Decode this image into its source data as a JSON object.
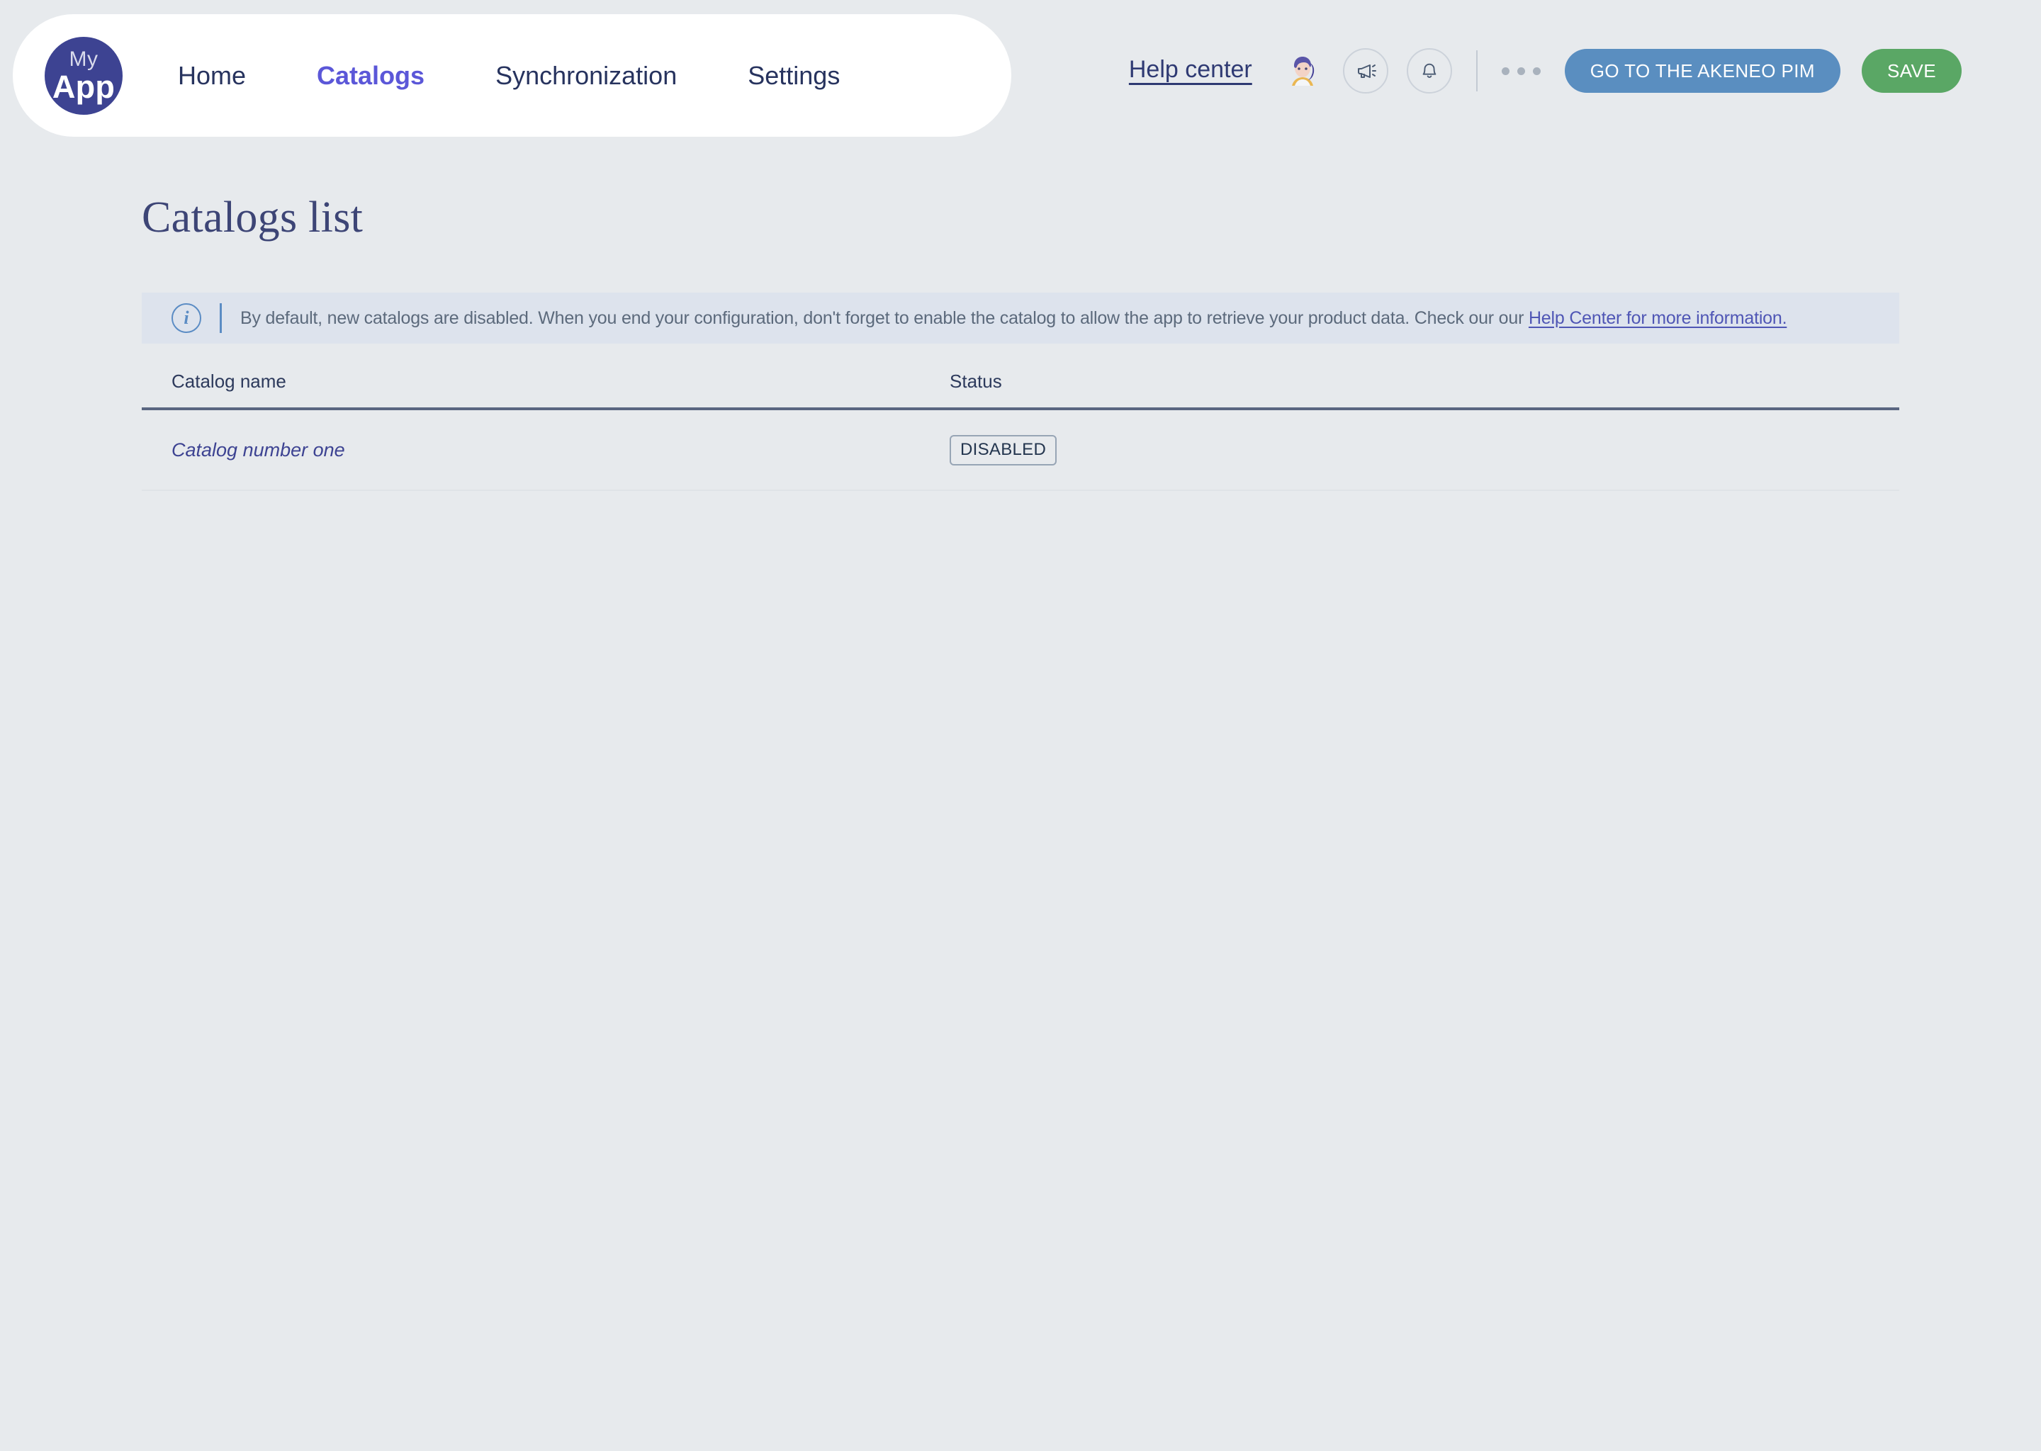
{
  "app": {
    "logo_line1": "My",
    "logo_line2": "App",
    "brand_color": "#3d4392",
    "background_color": "#e7eaed"
  },
  "nav": {
    "items": [
      {
        "label": "Home",
        "active": false
      },
      {
        "label": "Catalogs",
        "active": true
      },
      {
        "label": "Synchronization",
        "active": false
      },
      {
        "label": "Settings",
        "active": false
      }
    ],
    "active_color": "#5b57d8",
    "inactive_color": "#27335e"
  },
  "topbar": {
    "help_center_label": "Help center",
    "avatar_icon": "user-avatar-icon",
    "megaphone_icon": "megaphone-icon",
    "bell_icon": "bell-icon",
    "more_icon": "more-dots-icon",
    "pim_button_label": "GO TO THE AKENEO PIM",
    "pim_button_color": "#5a8ec0",
    "save_button_label": "SAVE",
    "save_button_color": "#5aa765"
  },
  "main": {
    "title": "Catalogs list",
    "banner": {
      "icon": "info-circle-icon",
      "text_before_link": "By default, new catalogs are disabled. When you end your configuration, don't forget to enable the catalog to allow the app to retrieve your product data. Check our our ",
      "link_label": "Help Center for more information.",
      "background_color": "#dde3ed",
      "accent_color": "#5b8cc4"
    },
    "table": {
      "columns": [
        {
          "key": "catalog_name",
          "label": "Catalog name"
        },
        {
          "key": "status",
          "label": "Status"
        }
      ],
      "rows": [
        {
          "catalog_name": "Catalog number one",
          "status": "DISABLED"
        }
      ]
    }
  }
}
